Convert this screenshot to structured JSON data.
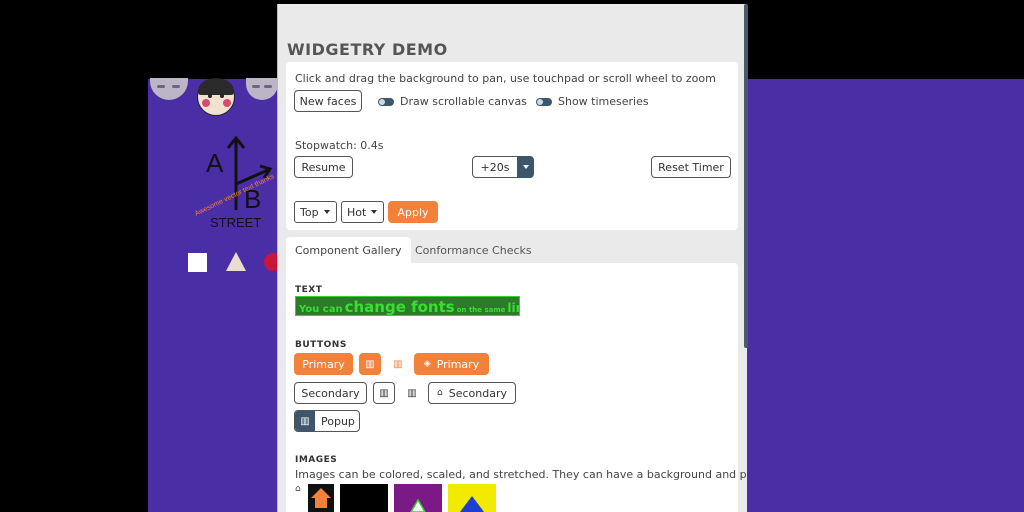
{
  "panel": {
    "title": "WIDGETRY DEMO",
    "instructions": "Click and drag the background to pan, use touchpad or scroll wheel to zoom",
    "new_faces_label": "New faces",
    "toggle_scrollable": "Draw scrollable canvas",
    "toggle_timeseries": "Show timeseries",
    "stopwatch": "Stopwatch: 0.4s",
    "resume_label": "Resume",
    "plus20_label": "+20s",
    "reset_label": "Reset Timer",
    "dropdown1": "Top",
    "dropdown2": "Hot",
    "apply_label": "Apply"
  },
  "tabs": {
    "gallery": "Component Gallery",
    "conformance": "Conformance Checks"
  },
  "gallery": {
    "text_heading": "TEXT",
    "text_parts": [
      "You can",
      "change fonts",
      "on the same",
      "line!"
    ],
    "buttons_heading": "BUTTONS",
    "primary_label": "Primary",
    "primary_icon_label": "Primary",
    "secondary_label": "Secondary",
    "secondary_icon_label": "Secondary",
    "popup_label": "Popup",
    "images_heading": "IMAGES",
    "images_desc": "Images can be colored, scaled, and stretched. They can have a background and padding."
  },
  "canvas": {
    "street_top_left": "A",
    "street_bottom_right": "B",
    "street_word": "STREET",
    "vector_text": "Awesome vector text thanks",
    "colors": {
      "background": "#4a2ea6",
      "accent_orange": "#f2813c",
      "dark_slate": "#3d566b",
      "text_green": "#39e12f"
    }
  }
}
